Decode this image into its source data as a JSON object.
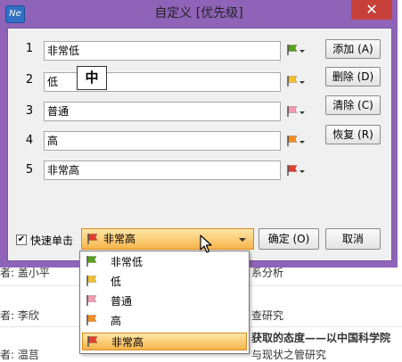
{
  "background": {
    "rows": [
      {
        "left": "者: 盖小平",
        "right": "系分析"
      },
      {
        "left": "者: 李欣",
        "right": "查研究"
      },
      {
        "left": "者: 温莒",
        "right": "获取的态度——以中国科学院",
        "right2": "与现状之管研究"
      }
    ]
  },
  "dialog": {
    "app_icon_text": "Ne",
    "title": "自定义 [优先级]",
    "close_glyph": "✕",
    "rows": [
      {
        "num": "1",
        "value": "非常低",
        "flag_color": "#5aa01e"
      },
      {
        "num": "2",
        "value": "低",
        "flag_color": "#f2c12e"
      },
      {
        "num": "3",
        "value": "普通",
        "flag_color": "#f29ab0"
      },
      {
        "num": "4",
        "value": "高",
        "flag_color": "#f28c1e"
      },
      {
        "num": "5",
        "value": "非常高",
        "flag_color": "#e0402f"
      }
    ],
    "buttons": {
      "add": "添加 (A)",
      "delete": "删除 (D)",
      "clear": "清除 (C)",
      "restore": "恢复 (R)",
      "ok": "确定 (O)",
      "cancel": "取消"
    },
    "ime_char": "中",
    "quick_click": {
      "checked": true,
      "label": "快速单击",
      "check_glyph": "✔"
    },
    "combo": {
      "selected": "非常高",
      "flag_color": "#e0402f"
    }
  },
  "dropdown": {
    "options": [
      {
        "label": "非常低",
        "flag_color": "#5aa01e"
      },
      {
        "label": "低",
        "flag_color": "#f2c12e"
      },
      {
        "label": "普通",
        "flag_color": "#f29ab0"
      },
      {
        "label": "高",
        "flag_color": "#f28c1e"
      },
      {
        "label": "非常高",
        "flag_color": "#e0402f",
        "selected": true
      }
    ]
  }
}
